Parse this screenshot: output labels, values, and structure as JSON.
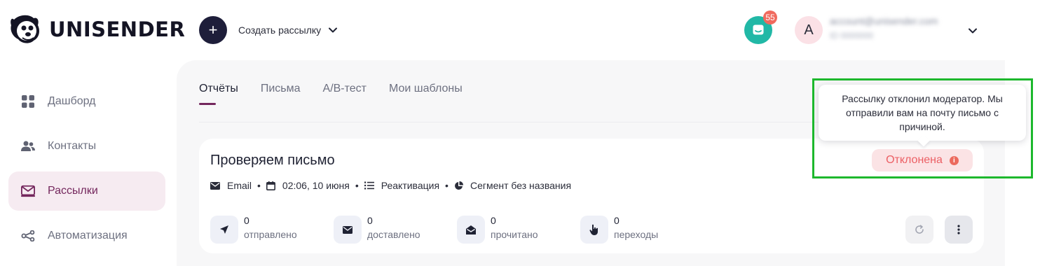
{
  "app": {
    "logo_text": "UNISENDER",
    "create_label": "Создать рассылку",
    "chat_badge": "55",
    "avatar_letter": "A",
    "account_email": "account@unisender.com",
    "account_id": "ID 0000000"
  },
  "sidebar": {
    "items": [
      {
        "label": "Дашборд",
        "icon": "dashboard-grid-icon"
      },
      {
        "label": "Контакты",
        "icon": "users-icon"
      },
      {
        "label": "Рассылки",
        "icon": "mail-icon",
        "active": true
      },
      {
        "label": "Автоматизация",
        "icon": "share-nodes-icon"
      }
    ]
  },
  "tabs": [
    {
      "label": "Отчёты",
      "active": true
    },
    {
      "label": "Письма"
    },
    {
      "label": "A/B-тест"
    },
    {
      "label": "Мои шаблоны"
    }
  ],
  "campaign": {
    "title": "Проверяем письмо",
    "channel": "Email",
    "datetime": "02:06, 10 июня",
    "list": "Реактивация",
    "segment": "Сегмент без названия",
    "status": "Отклонена",
    "tooltip": "Рассылку отклонил модератор. Мы отправили вам на почту письмо с причиной.",
    "stats": [
      {
        "value": "0",
        "label": "отправлено",
        "icon": "send-icon"
      },
      {
        "value": "0",
        "label": "доставлено",
        "icon": "envelope-icon"
      },
      {
        "value": "0",
        "label": "прочитано",
        "icon": "open-envelope-icon"
      },
      {
        "value": "0",
        "label": "переходы",
        "icon": "pointer-hand-icon"
      }
    ]
  },
  "colors": {
    "brand_dark": "#1e1e3a",
    "accent": "#74275d",
    "chat": "#21b8a6",
    "badge": "#f06a5e",
    "status_rejected": "#ec5f64",
    "highlight": "#1db82d"
  }
}
